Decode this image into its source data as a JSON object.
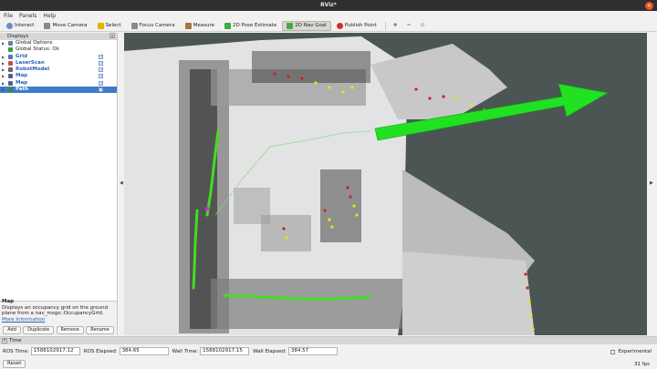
{
  "window": {
    "title": "RViz*"
  },
  "menu": [
    "File",
    "Panels",
    "Help"
  ],
  "toolbar": {
    "tools": [
      {
        "label": "Interact",
        "icon": "interact-icon",
        "color": "#6a8fc7"
      },
      {
        "label": "Move Camera",
        "icon": "move-camera-icon",
        "color": "#8a8a8a"
      },
      {
        "label": "Select",
        "icon": "select-icon",
        "color": "#e0b400"
      },
      {
        "label": "Focus Camera",
        "icon": "focus-camera-icon",
        "color": "#8a8a8a"
      },
      {
        "label": "Measure",
        "icon": "measure-icon",
        "color": "#a07840"
      },
      {
        "label": "2D Pose Estimate",
        "icon": "pose-estimate-icon",
        "color": "#3fae3f"
      },
      {
        "label": "2D Nav Goal",
        "icon": "nav-goal-icon",
        "color": "#3fae3f",
        "active": true
      },
      {
        "label": "Publish Point",
        "icon": "publish-point-icon",
        "color": "#d03030"
      }
    ]
  },
  "displays": {
    "title": "Displays",
    "items": [
      {
        "label": "Global Options",
        "icon": "gear-icon",
        "style": "normal",
        "expandable": true,
        "checked": null
      },
      {
        "label": "Global Status: Ok",
        "icon": "check-icon",
        "style": "normal",
        "expandable": false,
        "checked": null
      },
      {
        "label": "Grid",
        "icon": "grid-icon",
        "style": "blue",
        "expandable": true,
        "checked": true
      },
      {
        "label": "LaserScan",
        "icon": "laserscan-icon",
        "style": "blue",
        "expandable": true,
        "checked": true
      },
      {
        "label": "RobotModel",
        "icon": "robot-icon",
        "style": "blue",
        "expandable": true,
        "checked": true
      },
      {
        "label": "Map",
        "icon": "map-icon",
        "style": "blue",
        "expandable": true,
        "checked": true
      },
      {
        "label": "Map",
        "icon": "map-icon",
        "style": "blue",
        "expandable": true,
        "checked": true
      },
      {
        "label": "Path",
        "icon": "path-icon",
        "style": "selected",
        "expandable": true,
        "checked": true
      }
    ],
    "description": {
      "title": "Map",
      "text": "Displays an occupancy grid on the ground plane from a nav_msgs::OccupancyGrid.",
      "link": "More Information"
    },
    "buttons": [
      "Add",
      "Duplicate",
      "Remove",
      "Rename"
    ]
  },
  "time": {
    "title": "Time",
    "ros_time_label": "ROS Time:",
    "ros_time": "1588102917.12",
    "ros_elapsed_label": "ROS Elapsed:",
    "ros_elapsed": "384.65",
    "wall_time_label": "Wall Time:",
    "wall_time": "1588102917.15",
    "wall_elapsed_label": "Wall Elapsed:",
    "wall_elapsed": "384.57",
    "experimental_label": "Experimental",
    "reset_label": "Reset",
    "fps": "31 fps"
  },
  "colors": {
    "background": "#4b5654",
    "free_space": "#d9d9d9",
    "nav_goal_arrow": "#22e022",
    "path": "#7fd87f",
    "scan_low": "#d02020",
    "scan_high": "#e8e800",
    "trail": "#44dd22"
  }
}
